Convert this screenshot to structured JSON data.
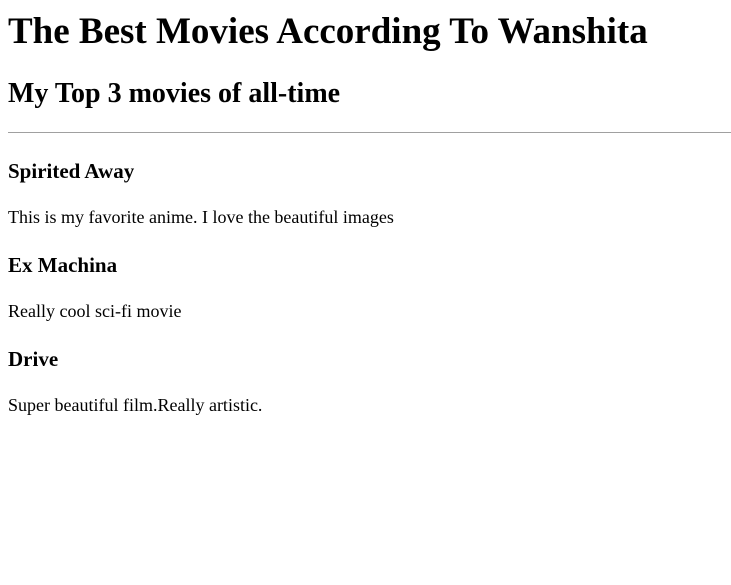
{
  "page": {
    "title": "The Best Movies According To Wanshita",
    "subtitle": "My Top 3 movies of all-time"
  },
  "movies": [
    {
      "title": "Spirited Away",
      "description": "This is my favorite anime. I love the beautiful images"
    },
    {
      "title": "Ex Machina",
      "description": "Really cool sci-fi movie"
    },
    {
      "title": "Drive",
      "description": "Super beautiful film.Really artistic."
    }
  ]
}
